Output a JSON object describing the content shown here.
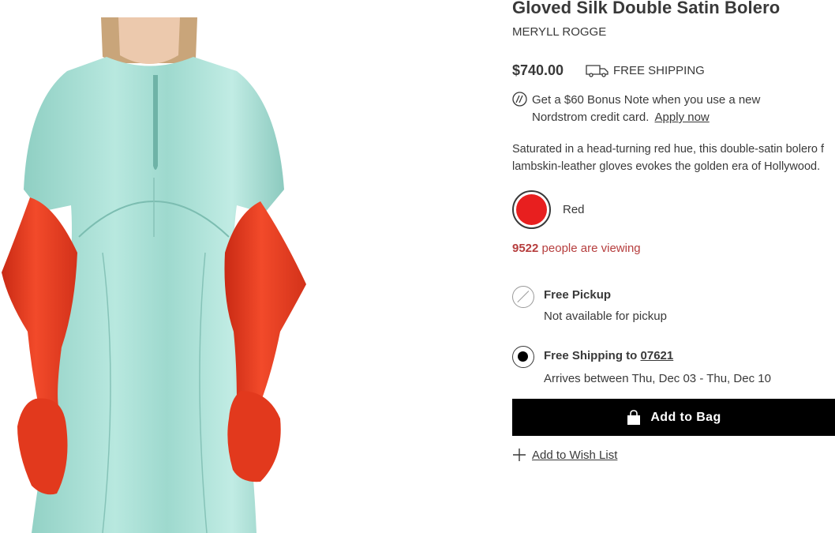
{
  "product": {
    "title": "Gloved Silk Double Satin Bolero",
    "brand": "MERYLL ROGGE",
    "price": "$740.00",
    "shipping_badge": "FREE SHIPPING"
  },
  "bonus": {
    "line1": "Get a $60 Bonus Note when you use a new",
    "line2": "Nordstrom credit card.",
    "apply_link": "Apply now"
  },
  "description": {
    "line1": "Saturated in a head-turning red hue, this double-satin bolero f",
    "line2": "lambskin-leather gloves evokes the golden era of Hollywood."
  },
  "color": {
    "selected_label": "Red",
    "swatch_hex": "#e81f1f"
  },
  "viewing": {
    "count": "9522",
    "text": "people are viewing"
  },
  "fulfillment": {
    "pickup": {
      "title": "Free Pickup",
      "subtitle": "Not available for pickup",
      "state": "disabled"
    },
    "shipping": {
      "title_prefix": "Free Shipping to",
      "zip": "07621",
      "subtitle": "Arrives between Thu, Dec 03 - Thu, Dec 10",
      "state": "selected"
    }
  },
  "actions": {
    "add_to_bag": "Add to Bag",
    "add_to_wishlist": "Add to Wish List"
  },
  "icons": {
    "truck": "truck-icon",
    "nordstrom_card": "nordstrom-card-icon",
    "bag": "shopping-bag-icon",
    "plus": "plus-icon"
  },
  "colors": {
    "text": "#393939",
    "accent_red": "#b63e3e",
    "button_bg": "#000000",
    "dress": "#9fd9cf",
    "gloves": "#e8391f"
  }
}
